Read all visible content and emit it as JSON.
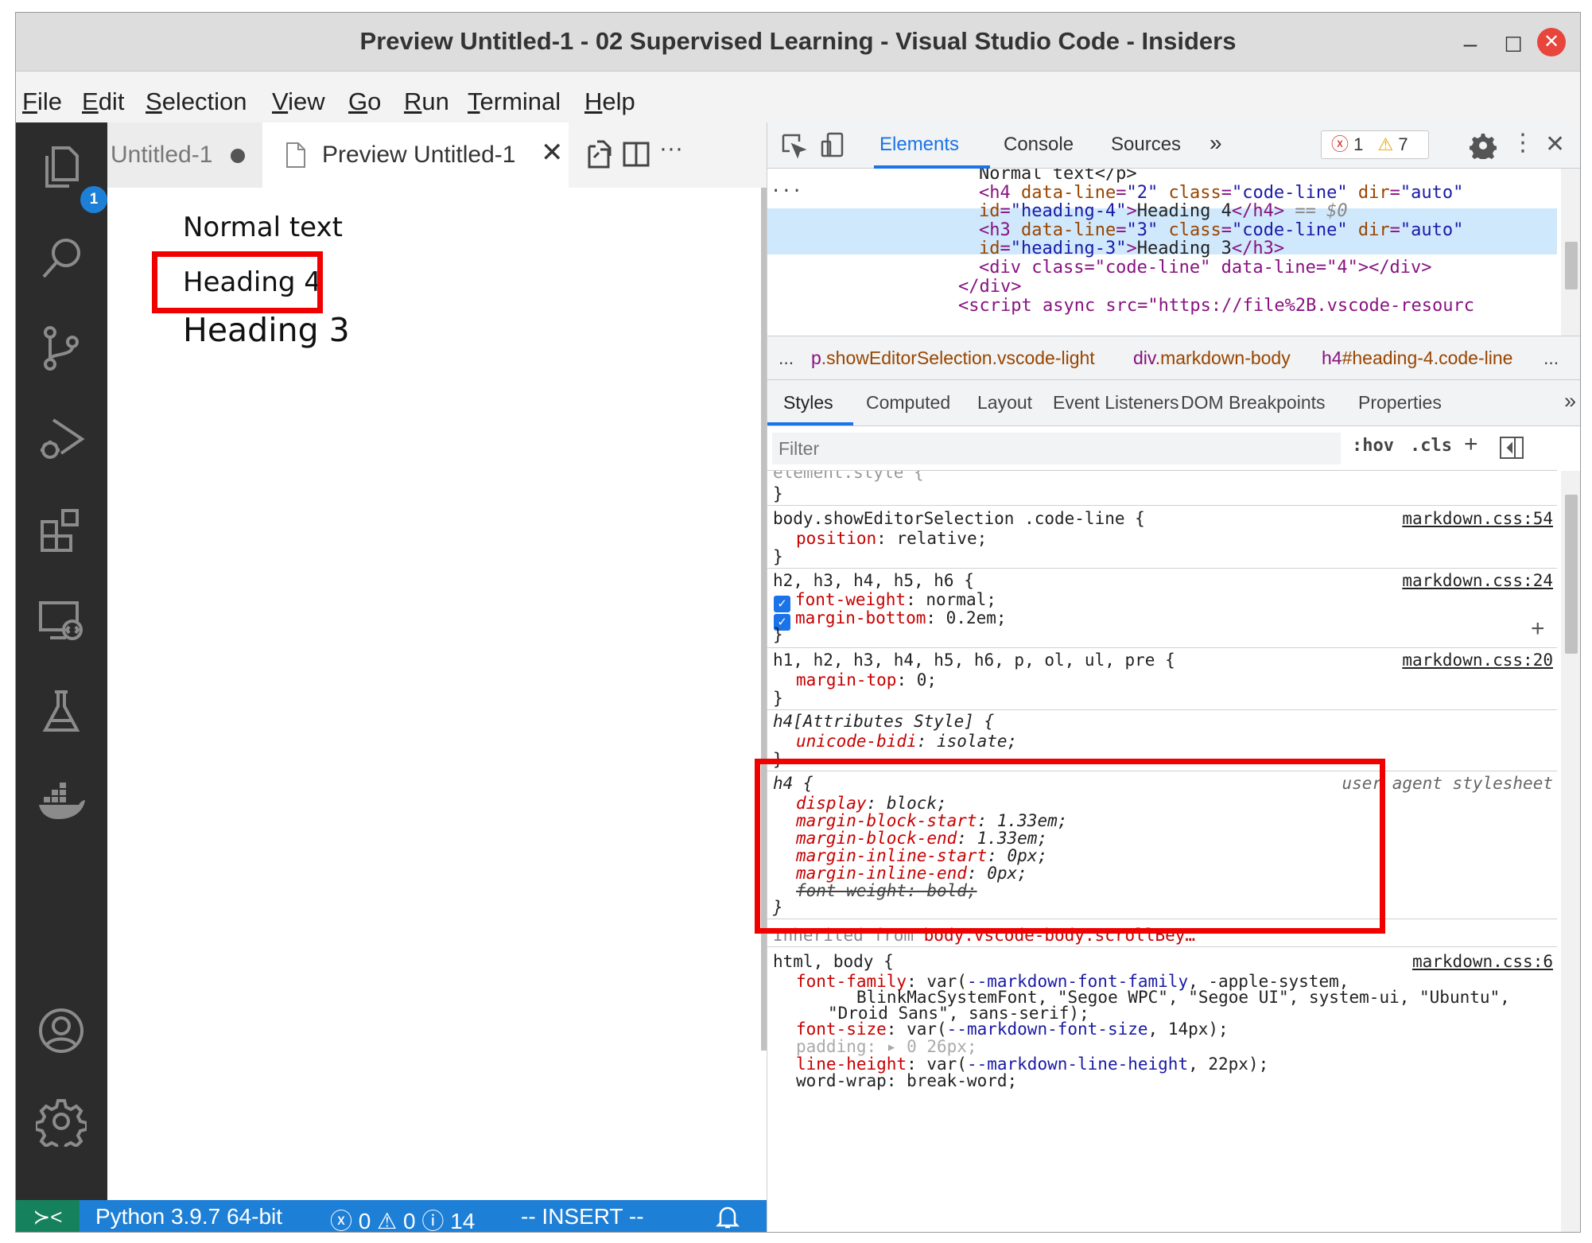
{
  "window": {
    "title": "Preview Untitled-1 - 02 Supervised Learning - Visual Studio Code - Insiders",
    "minimize": "–",
    "maximize": "☐",
    "close": "✕"
  },
  "menubar": {
    "items": [
      {
        "label": "File",
        "mnemonic": "F",
        "rest": "ile"
      },
      {
        "label": "Edit",
        "mnemonic": "E",
        "rest": "dit"
      },
      {
        "label": "Selection",
        "mnemonic": "S",
        "rest": "election"
      },
      {
        "label": "View",
        "mnemonic": "V",
        "rest": "iew"
      },
      {
        "label": "Go",
        "mnemonic": "G",
        "rest": "o"
      },
      {
        "label": "Run",
        "mnemonic": "R",
        "rest": "un"
      },
      {
        "label": "Terminal",
        "mnemonic": "T",
        "rest": "erminal"
      },
      {
        "label": "Help",
        "mnemonic": "H",
        "rest": "elp"
      }
    ]
  },
  "activity_bar": {
    "explorer_badge": "1",
    "icons": [
      "explorer-icon",
      "search-icon",
      "source-control-icon",
      "run-debug-icon",
      "extensions-icon",
      "remote-explorer-icon",
      "testing-icon",
      "docker-icon",
      "accounts-icon",
      "manage-gear-icon"
    ]
  },
  "tabs": {
    "tab1": "Untitled-1",
    "tab2": "Preview Untitled-1",
    "tab2_close": "✕",
    "more": "···"
  },
  "preview": {
    "normal_text": "Normal text",
    "heading4": "Heading 4",
    "heading3": "Heading 3"
  },
  "statusbar": {
    "remote": "≻<",
    "python": "Python 3.9.7 64-bit",
    "errors": "0",
    "warnings": "0",
    "info": "14",
    "mode": "-- INSERT --"
  },
  "devtools": {
    "tabs": [
      "Elements",
      "Console",
      "Sources"
    ],
    "more_tabs": "»",
    "error_count": "1",
    "warning_count": "7",
    "elements": {
      "line0": "Normal text</p>",
      "h4_line1_tag": "<h4",
      "h4_line1_attrs": [
        {
          "name": "data-line",
          "value": "\"2\""
        },
        {
          "name": "class",
          "value": "\"code-line\""
        },
        {
          "name": "dir",
          "value": "\"auto\""
        }
      ],
      "h4_id_name": "id",
      "h4_id_value": "\"heading-4\"",
      "h4_text": "Heading 4",
      "h4_close": "</h4>",
      "h4_suffix": "== $0",
      "h3_line1_tag": "<h3",
      "h3_line1_attrs": [
        {
          "name": "data-line",
          "value": "\"3\""
        },
        {
          "name": "class",
          "value": "\"code-line\""
        },
        {
          "name": "dir",
          "value": "\"auto\""
        }
      ],
      "h3_id_value": "\"heading-3\"",
      "h3_text": "Heading 3",
      "h3_close": "</h3>",
      "div_line": "<div class=\"code-line\" data-line=\"4\"></div>",
      "div_close": "</div>",
      "script_line": "<script async src=\"https://file%2B.vscode-resourc",
      "ellipsis": "···"
    },
    "breadcrumbs": {
      "lead": "...",
      "c1_tag": "p",
      "c1_cls": ".showEditorSelection.vscode-light",
      "c2_tag": "div",
      "c2_cls": ".markdown-body",
      "c3_tag": "h4",
      "c3_cls": "#heading-4.code-line",
      "tail": "..."
    },
    "style_tabs": [
      "Styles",
      "Computed",
      "Layout",
      "Event Listeners",
      "DOM Breakpoints",
      "Properties"
    ],
    "style_more": "»",
    "filter_placeholder": "Filter",
    "hov": ":hov",
    "cls": ".cls",
    "plus": "+",
    "rules": {
      "r0_close": "}",
      "r1_selector": "body.showEditorSelection .code-line {",
      "r1_src": "markdown.css:54",
      "r1_prop": "position",
      "r1_val": "relative;",
      "r2_selector": "h2, h3, h4, h5, h6 {",
      "r2_src": "markdown.css:24",
      "r2_p1": "font-weight",
      "r2_v1": "normal;",
      "r2_p2": "margin-bottom",
      "r2_v2": "0.2em;",
      "r3_selector": "h1, h2, h3, h4, h5, h6, p, ol, ul, pre {",
      "r3_src": "markdown.css:20",
      "r3_prop": "margin-top",
      "r3_val": "0;",
      "r4_selector": "h4[Attributes Style] {",
      "r4_prop": "unicode-bidi",
      "r4_val": "isolate;",
      "r5_selector": "h4 {",
      "r5_src": "user agent stylesheet",
      "r5_props": [
        {
          "p": "display",
          "v": "block;"
        },
        {
          "p": "margin-block-start",
          "v": "1.33em;"
        },
        {
          "p": "margin-block-end",
          "v": "1.33em;"
        },
        {
          "p": "margin-inline-start",
          "v": "0px;"
        },
        {
          "p": "margin-inline-end",
          "v": "0px;"
        }
      ],
      "r5_struck": "font-weight: bold;",
      "inherited_label": "Inherited from ",
      "inherited_sel": "body.vscode-body.scrollBey…",
      "r6_selector": "html, body {",
      "r6_src": "markdown.css:6",
      "r6_ff_prop": "font-family",
      "r6_ff_var": "--markdown-font-family",
      "r6_ff_rest1": ", -apple-system,",
      "r6_ff_rest2": "BlinkMacSystemFont, \"Segoe WPC\", \"Segoe UI\", system-ui, \"Ubuntu\",",
      "r6_ff_rest3": "\"Droid Sans\", sans-serif);",
      "r6_fs_prop": "font-size",
      "r6_fs_var": "--markdown-font-size",
      "r6_fs_rest": ", 14px);",
      "r6_pad": "padding: ▸ 0 26px;",
      "r6_lh_prop": "line-height",
      "r6_lh_var": "--markdown-line-height",
      "r6_lh_rest": ", 22px);",
      "r6_ww": "word-wrap: break-word;"
    }
  }
}
